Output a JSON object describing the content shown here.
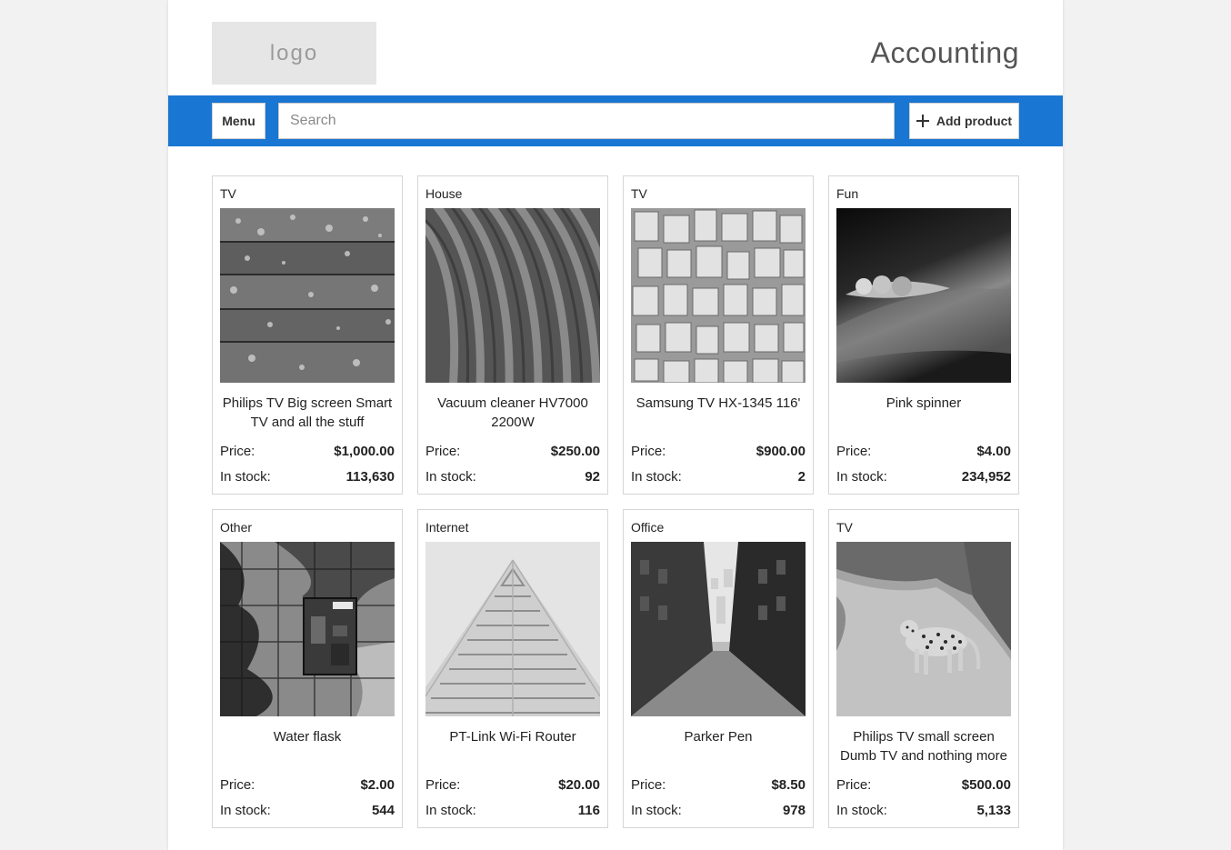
{
  "header": {
    "logo_text": "logo",
    "app_title": "Accounting"
  },
  "toolbar": {
    "menu_label": "Menu",
    "search_placeholder": "Search",
    "search_value": "",
    "add_label": "Add product",
    "accent_color": "#1976d2"
  },
  "labels": {
    "price": "Price:",
    "stock": "In stock:"
  },
  "products": [
    {
      "category": "TV",
      "name": "Philips TV Big screen Smart TV and all the stuff",
      "price": "$1,000.00",
      "stock": "113,630",
      "image": "wooden-planks-photo"
    },
    {
      "category": "House",
      "name": "Vacuum cleaner HV7000 2200W",
      "price": "$250.00",
      "stock": "92",
      "image": "lavender-field-photo"
    },
    {
      "category": "TV",
      "name": "Samsung TV HX-1345 116'",
      "price": "$900.00",
      "stock": "2",
      "image": "book-pages-photo"
    },
    {
      "category": "Fun",
      "name": "Pink spinner",
      "price": "$4.00",
      "stock": "234,952",
      "image": "seed-pod-photo"
    },
    {
      "category": "Other",
      "name": "Water flask",
      "price": "$2.00",
      "stock": "544",
      "image": "graffiti-wall-photo"
    },
    {
      "category": "Internet",
      "name": "PT-Link Wi-Fi Router",
      "price": "$20.00",
      "stock": "116",
      "image": "building-facade-photo"
    },
    {
      "category": "Office",
      "name": "Parker Pen",
      "price": "$8.50",
      "stock": "978",
      "image": "city-alley-photo"
    },
    {
      "category": "TV",
      "name": "Philips TV small screen Dumb TV and nothing more",
      "price": "$500.00",
      "stock": "5,133",
      "image": "leopard-path-photo"
    }
  ]
}
